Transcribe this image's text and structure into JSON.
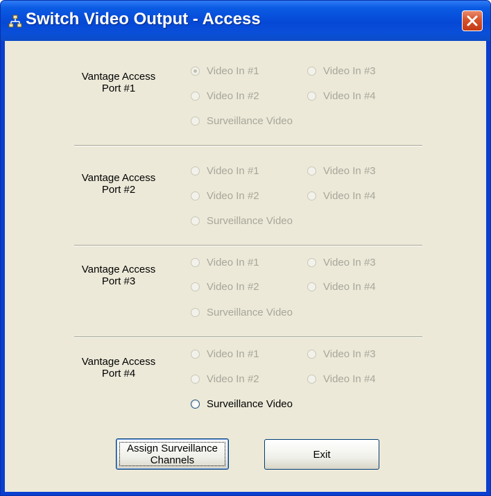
{
  "window": {
    "title": "Switch Video Output - Access",
    "icon": "network-icon",
    "close_icon": "close-icon"
  },
  "ports": [
    {
      "label_line1": "Vantage Access",
      "label_line2": "Port #1",
      "options": {
        "video1": {
          "label": "Video In #1",
          "checked": true,
          "enabled": false
        },
        "video3": {
          "label": "Video In #3",
          "checked": false,
          "enabled": false
        },
        "video2": {
          "label": "Video In #2",
          "checked": false,
          "enabled": false
        },
        "video4": {
          "label": "Video In #4",
          "checked": false,
          "enabled": false
        },
        "surveillance": {
          "label": "Surveillance Video",
          "checked": false,
          "enabled": false
        }
      }
    },
    {
      "label_line1": "Vantage Access",
      "label_line2": "Port #2",
      "options": {
        "video1": {
          "label": "Video In #1",
          "checked": false,
          "enabled": false
        },
        "video3": {
          "label": "Video In #3",
          "checked": false,
          "enabled": false
        },
        "video2": {
          "label": "Video In #2",
          "checked": false,
          "enabled": false
        },
        "video4": {
          "label": "Video In #4",
          "checked": false,
          "enabled": false
        },
        "surveillance": {
          "label": "Surveillance Video",
          "checked": false,
          "enabled": false
        }
      }
    },
    {
      "label_line1": "Vantage Access",
      "label_line2": "Port #3",
      "options": {
        "video1": {
          "label": "Video In #1",
          "checked": false,
          "enabled": false
        },
        "video3": {
          "label": "Video In #3",
          "checked": false,
          "enabled": false
        },
        "video2": {
          "label": "Video In #2",
          "checked": false,
          "enabled": false
        },
        "video4": {
          "label": "Video In #4",
          "checked": false,
          "enabled": false
        },
        "surveillance": {
          "label": "Surveillance Video",
          "checked": false,
          "enabled": false
        }
      }
    },
    {
      "label_line1": "Vantage Access",
      "label_line2": "Port #4",
      "options": {
        "video1": {
          "label": "Video In #1",
          "checked": false,
          "enabled": false
        },
        "video3": {
          "label": "Video In #3",
          "checked": false,
          "enabled": false
        },
        "video2": {
          "label": "Video In #2",
          "checked": false,
          "enabled": false
        },
        "video4": {
          "label": "Video In #4",
          "checked": false,
          "enabled": false
        },
        "surveillance": {
          "label": "Surveillance Video",
          "checked": false,
          "enabled": true
        }
      }
    }
  ],
  "buttons": {
    "assign_line1": "Assign Surveillance",
    "assign_line2": "Channels",
    "exit": "Exit"
  },
  "colors": {
    "titlebar": "#0548d6",
    "client_bg": "#ece9d8",
    "disabled_text": "#a7a69a",
    "close_button": "#d6532c"
  }
}
